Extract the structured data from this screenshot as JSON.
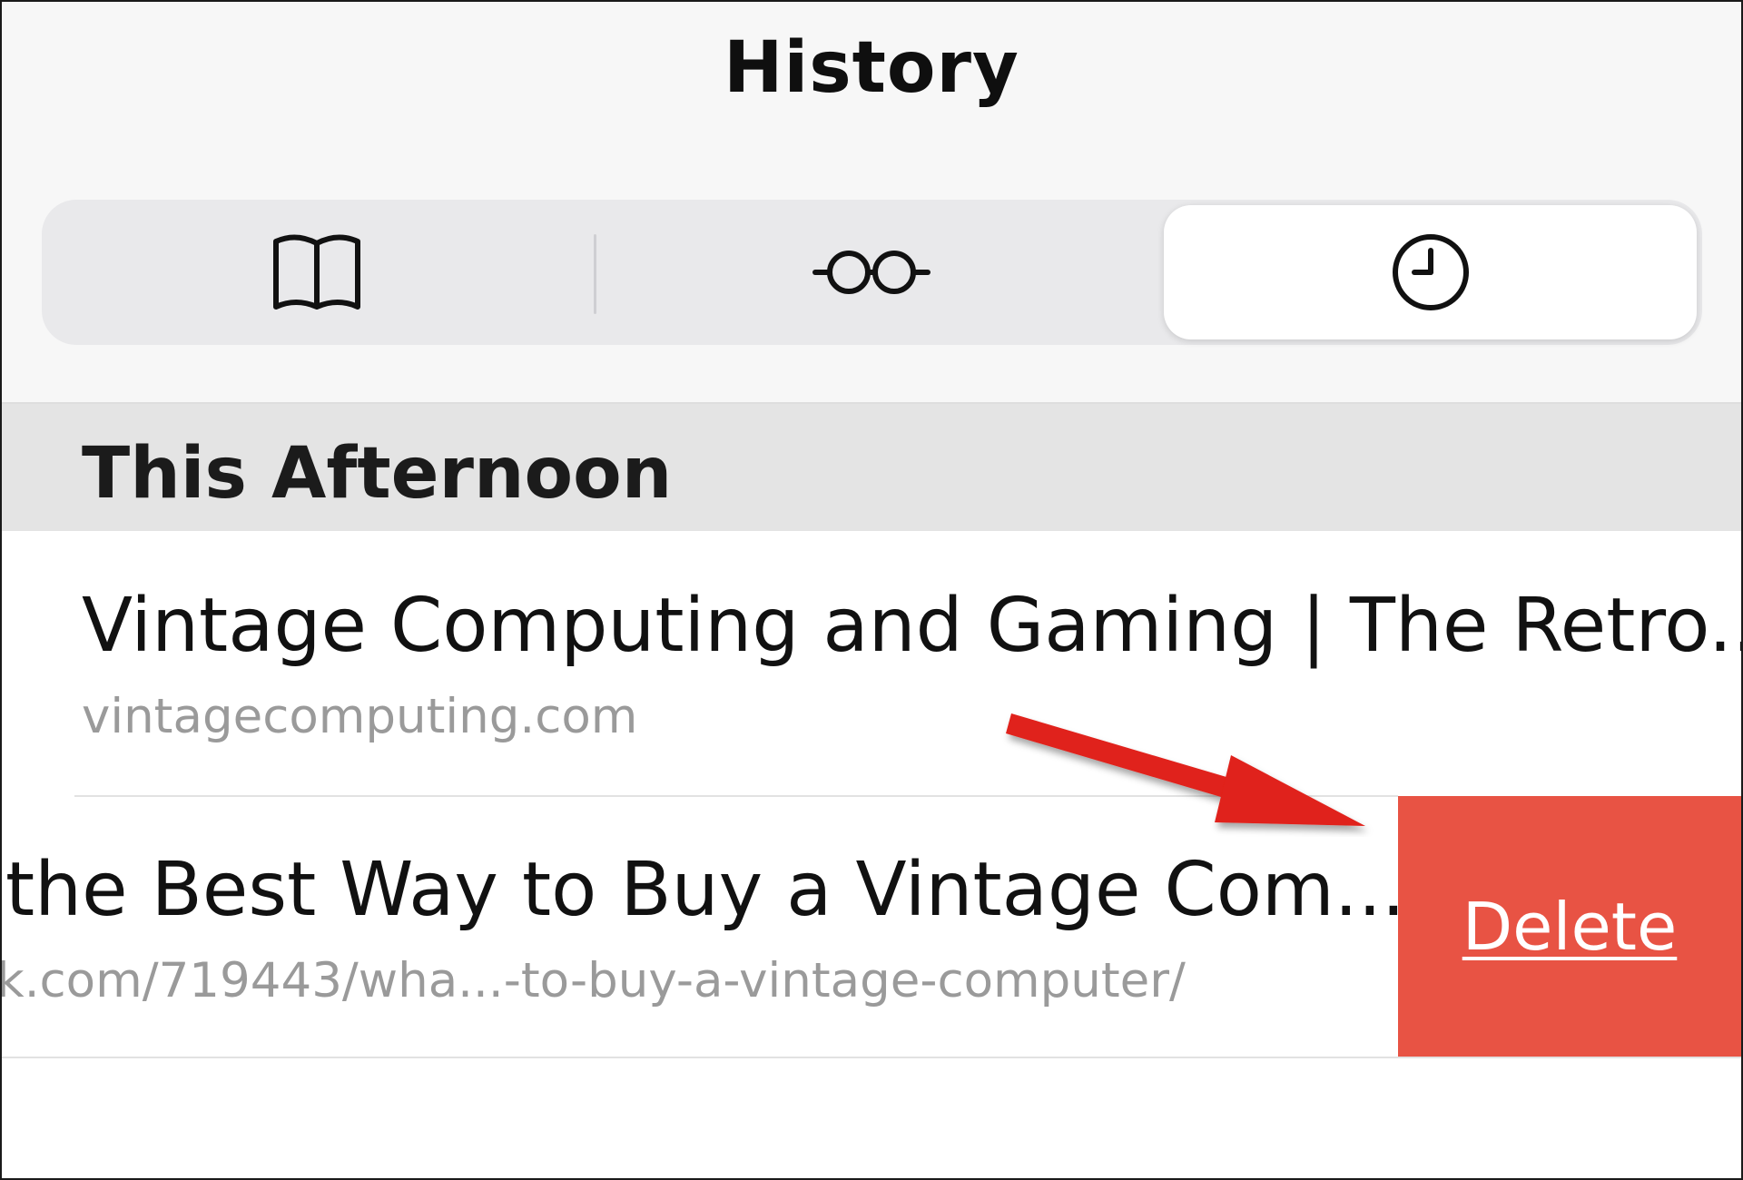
{
  "header": {
    "title": "History"
  },
  "segments": [
    {
      "icon": "book-icon",
      "label": "Bookmarks",
      "active": false
    },
    {
      "icon": "glasses-icon",
      "label": "Reading List",
      "active": false
    },
    {
      "icon": "clock-icon",
      "label": "History",
      "active": true
    }
  ],
  "section": {
    "label": "This Afternoon"
  },
  "items": [
    {
      "title": "Vintage Computing and Gaming | The Retro...",
      "url": "vintagecomputing.com"
    },
    {
      "title": "the Best Way to Buy a Vintage Com...",
      "url": "k.com/719443/wha...-to-buy-a-vintage-computer/"
    }
  ],
  "swipe_action": {
    "label": "Delete",
    "color": "#e85344"
  },
  "annotation": {
    "arrow_color": "#e0201a"
  },
  "colors": {
    "header_bg": "#f7f7f7",
    "section_bg": "#e4e4e4",
    "segment_bg": "#e9e9eb"
  }
}
